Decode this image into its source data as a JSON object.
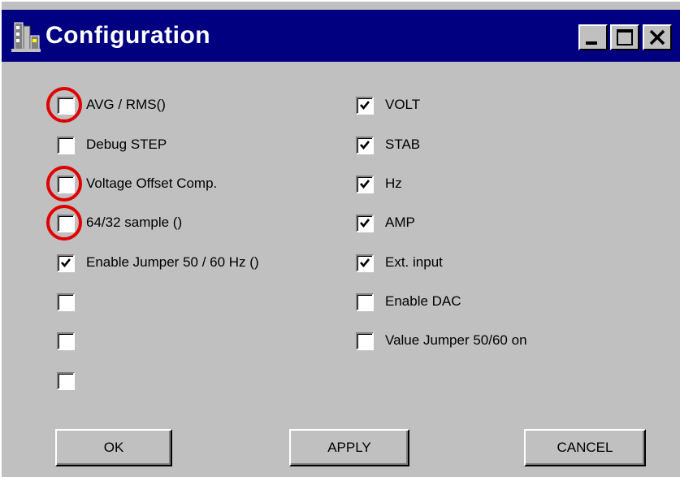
{
  "window": {
    "title": "Configuration",
    "app_icon": "app-icon",
    "controls": [
      "minimize-icon",
      "maximize-icon",
      "close-icon"
    ]
  },
  "left_options": [
    {
      "label": "AVG / RMS()",
      "checked": false,
      "highlighted": true
    },
    {
      "label": "Debug STEP",
      "checked": false,
      "highlighted": false
    },
    {
      "label": "Voltage Offset Comp.",
      "checked": false,
      "highlighted": true
    },
    {
      "label": "64/32 sample ()",
      "checked": false,
      "highlighted": true
    },
    {
      "label": "Enable Jumper 50 / 60 Hz ()",
      "checked": true,
      "highlighted": false
    },
    {
      "label": "",
      "checked": false,
      "highlighted": false
    },
    {
      "label": "",
      "checked": false,
      "highlighted": false
    },
    {
      "label": "",
      "checked": false,
      "highlighted": false
    }
  ],
  "right_options": [
    {
      "label": "VOLT",
      "checked": true
    },
    {
      "label": "STAB",
      "checked": true
    },
    {
      "label": "Hz",
      "checked": true
    },
    {
      "label": "AMP",
      "checked": true
    },
    {
      "label": "Ext. input",
      "checked": true
    },
    {
      "label": "Enable DAC",
      "checked": false
    },
    {
      "label": "Value Jumper 50/60 on",
      "checked": false
    }
  ],
  "buttons": {
    "ok": "OK",
    "apply": "APPLY",
    "cancel": "CANCEL"
  },
  "colors": {
    "titlebar": "#000080",
    "face": "#c0c0c0",
    "highlight_circle": "#e00000"
  }
}
